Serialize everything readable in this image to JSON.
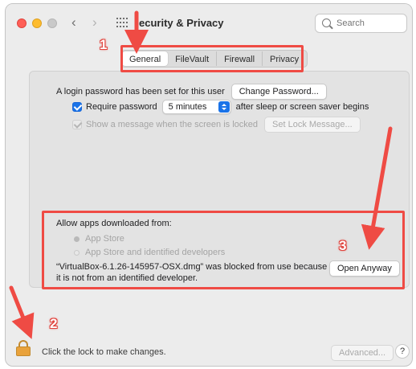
{
  "window": {
    "title": "ecurity & Privacy",
    "nav_back": "‹",
    "nav_forward": "›",
    "search_placeholder": "Search"
  },
  "tabs": [
    {
      "label": "General",
      "active": true
    },
    {
      "label": "FileVault",
      "active": false
    },
    {
      "label": "Firewall",
      "active": false
    },
    {
      "label": "Privacy",
      "active": false
    }
  ],
  "general": {
    "login_password_text": "A login password has been set for this user",
    "change_password_button": "Change Password...",
    "require_password_label": "Require password",
    "require_password_checked": true,
    "require_password_delay": "5 minutes",
    "after_sleep_text": "after sleep or screen saver begins",
    "show_message_label": "Show a message when the screen is locked",
    "set_lock_message_button": "Set Lock Message..."
  },
  "allow_apps": {
    "heading": "Allow apps downloaded from:",
    "options": [
      {
        "label": "App Store",
        "selected": true
      },
      {
        "label": "App Store and identified developers",
        "selected": false
      }
    ],
    "blocked_message_line1": "“VirtualBox-6.1.26-145957-OSX.dmg” was blocked from use because",
    "blocked_message_line2": "it is not from an identified developer.",
    "open_anyway_button": "Open Anyway"
  },
  "footer": {
    "lock_text": "Click the lock to make changes.",
    "advanced_button": "Advanced...",
    "help_button": "?"
  },
  "annotations": {
    "labels": [
      "1",
      "2",
      "3"
    ],
    "color": "#ef4b44"
  }
}
